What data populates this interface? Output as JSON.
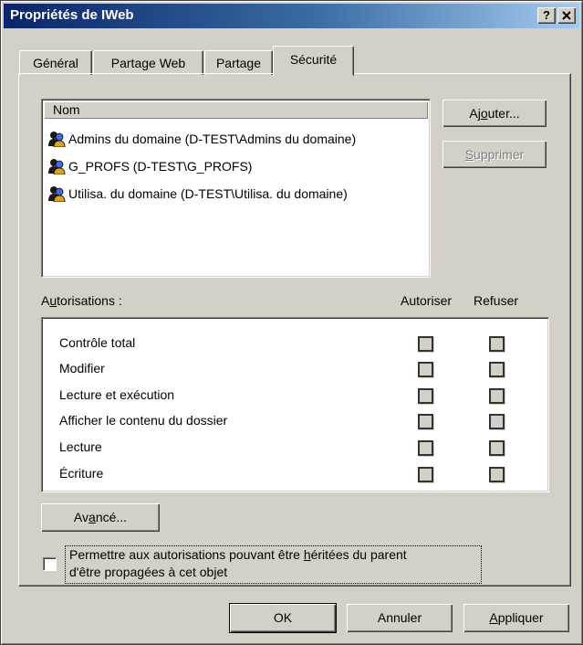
{
  "window": {
    "title": "Propriétés de IWeb",
    "help_button": "?",
    "close_button": "X"
  },
  "tabs": [
    {
      "label": "Général"
    },
    {
      "label": "Partage Web"
    },
    {
      "label": "Partage"
    },
    {
      "label": "Sécurité"
    }
  ],
  "users": {
    "column_header": "Nom",
    "items": [
      {
        "name": "Admins du domaine (D-TEST\\Admins du domaine)"
      },
      {
        "name": "G_PROFS (D-TEST\\G_PROFS)"
      },
      {
        "name": "Utilisa. du domaine (D-TEST\\Utilisa. du domaine)"
      }
    ],
    "add_prefix": "Aj",
    "add_u": "o",
    "add_suffix": "uter...",
    "remove_u": "S",
    "remove_suffix": "upprimer"
  },
  "permissions": {
    "label_prefix": "A",
    "label_u": "u",
    "label_suffix": "torisations :",
    "allow_header": "Autoriser",
    "deny_header": "Refuser",
    "items": [
      {
        "name": "Contrôle total",
        "allow": false,
        "deny": false
      },
      {
        "name": "Modifier",
        "allow": false,
        "deny": false
      },
      {
        "name": "Lecture et exécution",
        "allow": false,
        "deny": false
      },
      {
        "name": "Afficher le contenu du dossier",
        "allow": false,
        "deny": false
      },
      {
        "name": "Lecture",
        "allow": false,
        "deny": false
      },
      {
        "name": "Écriture",
        "allow": false,
        "deny": false
      }
    ]
  },
  "advanced": {
    "prefix": "Av",
    "u": "a",
    "suffix": "ncé..."
  },
  "inherit": {
    "line1_prefix": "Permettre aux autorisations pouvant être ",
    "line1_u": "h",
    "line1_suffix": "éritées du parent",
    "line2": "d'être propagées à cet objet",
    "checked": false
  },
  "footer": {
    "ok": "OK",
    "cancel": "Annuler",
    "apply_u": "A",
    "apply_suffix": "ppliquer"
  }
}
